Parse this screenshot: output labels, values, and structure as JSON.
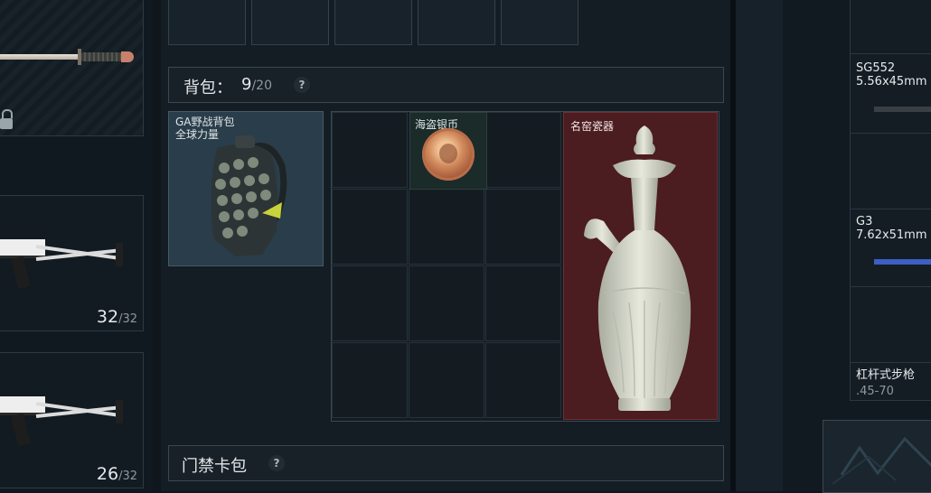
{
  "left": {
    "ammo_slots": [
      {
        "current": "32",
        "max": "/32"
      },
      {
        "current": "26",
        "max": "/32"
      }
    ]
  },
  "backpack_section": {
    "title": "背包：",
    "count": "9",
    "capacity": "/20",
    "help": "?",
    "equipped_name": "GA野战背包\n全球力量"
  },
  "inventory": {
    "items": [
      {
        "name": "海盗银币"
      },
      {
        "name": "名窑瓷器"
      }
    ]
  },
  "keycard_section": {
    "title": "门禁卡包",
    "help": "?"
  },
  "right_weapons": [
    {
      "name": "SG552",
      "caliber": "5.56x45mm"
    },
    {
      "name": "G3",
      "caliber": "7.62x51mm"
    },
    {
      "name": "杠杆式步枪",
      "caliber": ".45-70"
    }
  ],
  "colors": {
    "vase_cell_bg": "#4b1c20",
    "coin_cell_bg": "#1a2b2a",
    "backpack_card_bg": "#2a3d4a"
  }
}
